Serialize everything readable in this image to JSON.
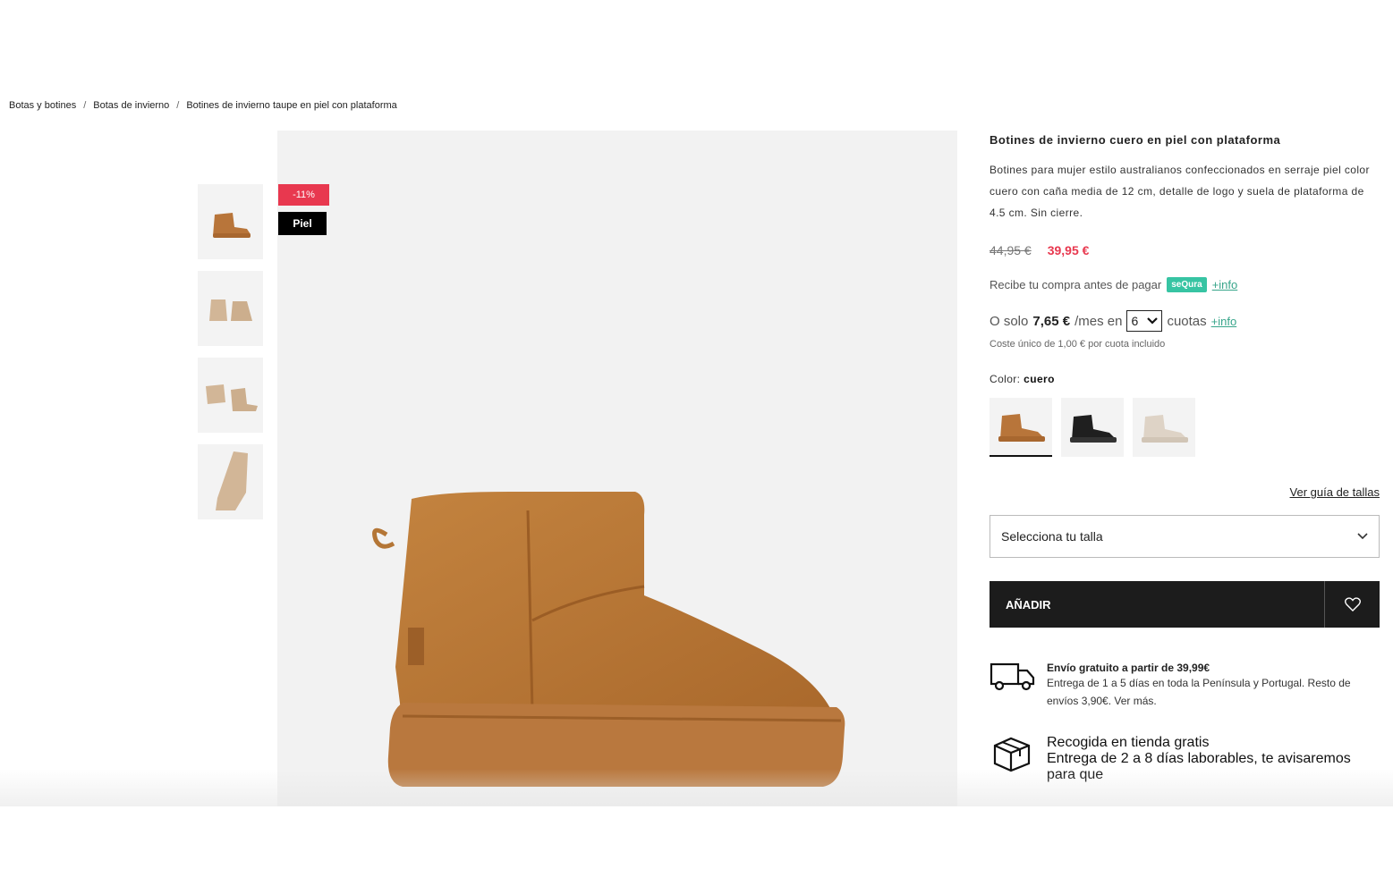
{
  "breadcrumb": {
    "items": [
      "Botas y botines",
      "Botas de invierno",
      "Botines de invierno taupe en piel con plataforma"
    ],
    "separator": "/"
  },
  "badges": {
    "discount": "-11%",
    "material": "Piel"
  },
  "product": {
    "title": "Botines de invierno cuero en piel con plataforma",
    "description": "Botines para mujer estilo australianos confeccionados en serraje piel color cuero con caña media de 12 cm, detalle de logo y suela de plataforma de 4.5 cm. Sin cierre.",
    "old_price": "44,95 €",
    "price": "39,95 €"
  },
  "sequra": {
    "text": "Recibe tu compra antes de pagar",
    "logo": "seQura",
    "info": "+info"
  },
  "installments": {
    "prefix": "O solo",
    "amount": "7,65 €",
    "per": "/mes en",
    "count": "6",
    "suffix": "cuotas",
    "info": "+info",
    "cost_note": "Coste único de 1,00 € por cuota incluido"
  },
  "color": {
    "label": "Color:",
    "value": "cuero",
    "swatches": [
      {
        "name": "cuero",
        "hex": "#b8753a"
      },
      {
        "name": "negro",
        "hex": "#1c1c1c"
      },
      {
        "name": "beige",
        "hex": "#e2d8cc"
      }
    ]
  },
  "size": {
    "guide_link": "Ver guía de tallas",
    "select_placeholder": "Selecciona tu talla"
  },
  "actions": {
    "add_label": "AÑADIR"
  },
  "shipping": {
    "free_title": "Envío gratuito a partir de 39,99€",
    "free_desc": "Entrega de 1 a 5 días en toda la Península y Portugal. Resto de envíos 3,90€. Ver más.",
    "pickup_title": "Recogida en tienda gratis",
    "pickup_desc": "Entrega de 2 a 8 días laborables, te avisaremos para que"
  },
  "colors": {
    "accent_red": "#e8384f",
    "sequra_green": "#37c4a3",
    "boot_tan": "#b8753a",
    "dark": "#1c1c1c"
  }
}
